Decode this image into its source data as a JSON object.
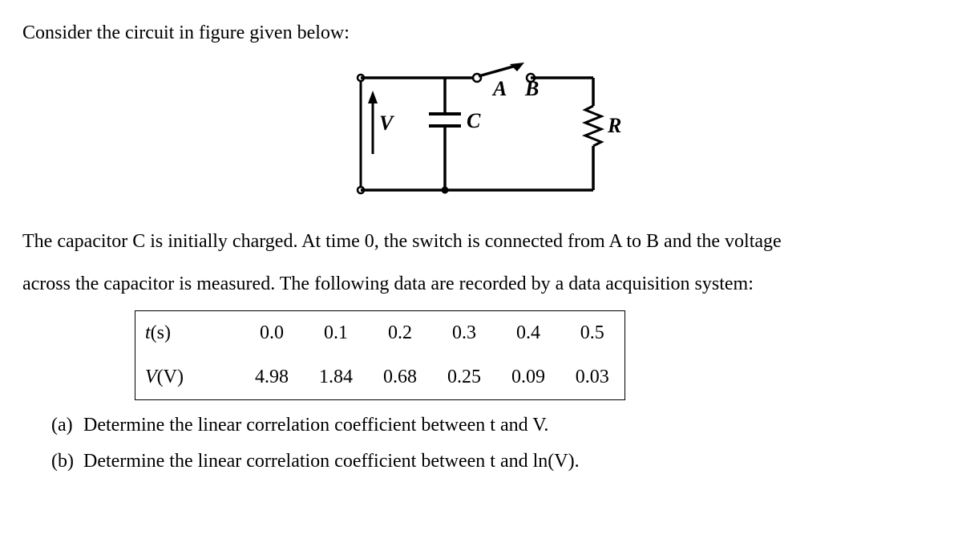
{
  "intro": "Consider the circuit in figure given below:",
  "circuit": {
    "V": "V",
    "C": "C",
    "A": "A",
    "B": "B",
    "R": "R"
  },
  "desc1": "The capacitor C is initially charged. At time 0, the switch is connected from A to B and the voltage",
  "desc2": "across the capacitor is measured. The following data are recorded by a data acquisition system:",
  "table": {
    "row1_head": "t",
    "row1_unit": "(s)",
    "row2_head": "V",
    "row2_unit": "(V)",
    "t": [
      "0.0",
      "0.1",
      "0.2",
      "0.3",
      "0.4",
      "0.5"
    ],
    "V": [
      "4.98",
      "1.84",
      "0.68",
      "0.25",
      "0.09",
      "0.03"
    ]
  },
  "qa_label": "(a)",
  "qa_text": "Determine the linear correlation coefficient between t and V.",
  "qb_label": "(b)",
  "qb_text": "Determine the linear correlation coefficient between t and ln(V).",
  "chart_data": {
    "type": "table",
    "title": "Capacitor discharge voltage vs time",
    "xlabel": "t (s)",
    "ylabel": "V (V)",
    "x": [
      0.0,
      0.1,
      0.2,
      0.3,
      0.4,
      0.5
    ],
    "y": [
      4.98,
      1.84,
      0.68,
      0.25,
      0.09,
      0.03
    ]
  }
}
